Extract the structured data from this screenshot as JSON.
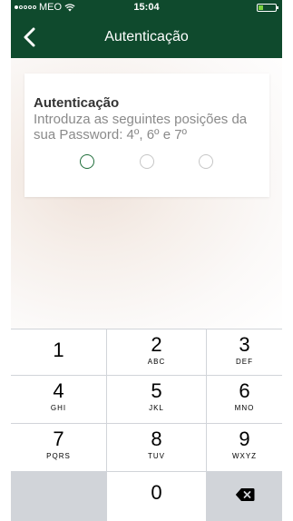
{
  "statusbar": {
    "carrier": "MEO",
    "time": "15:04",
    "signal_full": 1,
    "signal_total": 5,
    "icons": [
      "wifi-icon",
      "battery-icon"
    ],
    "battery_level": 0.2
  },
  "navbar": {
    "title": "Autenticação",
    "back_icon": "chevron-left-icon"
  },
  "card": {
    "title": "Autenticação",
    "text": "Introduza as seguintes posições da sua Password: 4º, 6º e 7º",
    "positions_total": 3,
    "active_position": 1
  },
  "keypad": {
    "keys": [
      {
        "num": "1",
        "letters": ""
      },
      {
        "num": "2",
        "letters": "ABC"
      },
      {
        "num": "3",
        "letters": "DEF"
      },
      {
        "num": "4",
        "letters": "GHI"
      },
      {
        "num": "5",
        "letters": "JKL"
      },
      {
        "num": "6",
        "letters": "MNO"
      },
      {
        "num": "7",
        "letters": "PQRS"
      },
      {
        "num": "8",
        "letters": "TUV"
      },
      {
        "num": "9",
        "letters": "WXYZ"
      },
      {
        "num": "0",
        "letters": ""
      }
    ],
    "delete_icon": "backspace-icon"
  },
  "colors": {
    "header": "#0f4a2d",
    "active_circle": "#1f6e3a",
    "keypad_bg": "#d1d4d9"
  }
}
